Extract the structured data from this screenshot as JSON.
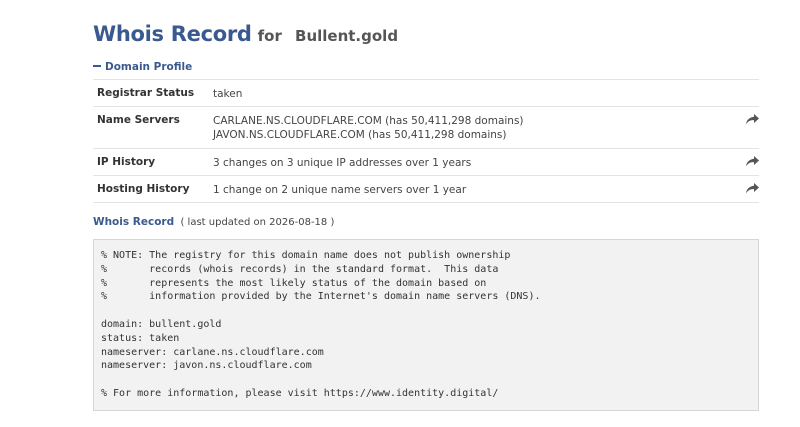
{
  "header": {
    "title_main": "Whois Record",
    "title_for": "for",
    "title_domain": "Bullent.gold"
  },
  "profile": {
    "toggle_label": "Domain Profile",
    "rows": [
      {
        "label": "Registrar Status",
        "lines": [
          "taken"
        ],
        "has_action": false
      },
      {
        "label": "Name Servers",
        "lines": [
          "CARLANE.NS.CLOUDFLARE.COM (has 50,411,298 domains)",
          "JAVON.NS.CLOUDFLARE.COM (has 50,411,298 domains)"
        ],
        "has_action": true
      },
      {
        "label": "IP History",
        "lines": [
          "3 changes on 3 unique IP addresses over 1 years"
        ],
        "has_action": true
      },
      {
        "label": "Hosting History",
        "lines": [
          "1 change on 2 unique name servers over 1 year"
        ],
        "has_action": true
      }
    ]
  },
  "record": {
    "heading": "Whois Record",
    "updated_text": "( last updated on 2026-08-18 )",
    "raw": "% NOTE: The registry for this domain name does not publish ownership\n%       records (whois records) in the standard format.  This data\n%       represents the most likely status of the domain based on\n%       information provided by the Internet's domain name servers (DNS).\n\ndomain: bullent.gold\nstatus: taken\nnameserver: carlane.ns.cloudflare.com\nnameserver: javon.ns.cloudflare.com\n\n% For more information, please visit https://www.identity.digital/"
  },
  "icons": {
    "toggle": "minus-icon",
    "row_action": "share-arrow-icon"
  },
  "colors": {
    "accent": "#3a5a8f",
    "text": "#333333",
    "record_bg": "#f2f2f2",
    "divider": "#e3e3e3"
  }
}
